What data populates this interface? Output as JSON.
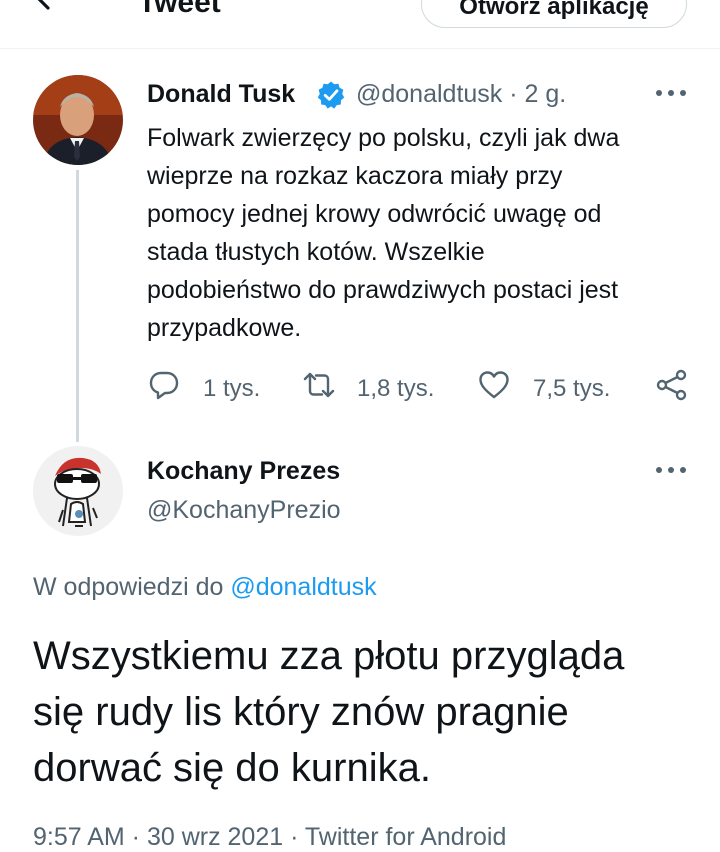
{
  "header": {
    "title": "Tweet",
    "open_app_label": "Otwórz aplikację"
  },
  "parent_tweet": {
    "author_name": "Donald Tusk",
    "author_handle": "@donaldtusk",
    "time": "· 2 g.",
    "verified": true,
    "text": "Folwark zwierzęcy po polsku, czyli jak dwa\nwieprze na rozkaz kaczora miały przy\npomocy jednej krowy odwrócić uwagę od\nstada tłustych kotów. Wszelkie\npodobieństwo do prawdziwych postaci jest\nprzypadkowe.",
    "actions": {
      "replies": "1 tys.",
      "retweets": "1,8 tys.",
      "likes": "7,5 tys."
    }
  },
  "reply_tweet": {
    "author_name": "Kochany Prezes",
    "author_handle": "@KochanyPrezio",
    "reply_prefix": "W odpowiedzi do",
    "reply_mention": "@donaldtusk",
    "text": "Wszystkiemu zza płotu przygląda\nsię rudy lis który znów pragnie\ndorwać się do kurnika.",
    "meta": "9:57 AM · 30 wrz 2021 · Twitter for Android"
  },
  "colors": {
    "accent": "#1d9bf0",
    "text_primary": "#0f1419",
    "text_secondary": "#536471",
    "border": "#cfd9de"
  },
  "icons": [
    "back-arrow-icon",
    "verified-badge-icon",
    "more-icon",
    "reply-icon",
    "retweet-icon",
    "like-icon",
    "share-icon"
  ]
}
